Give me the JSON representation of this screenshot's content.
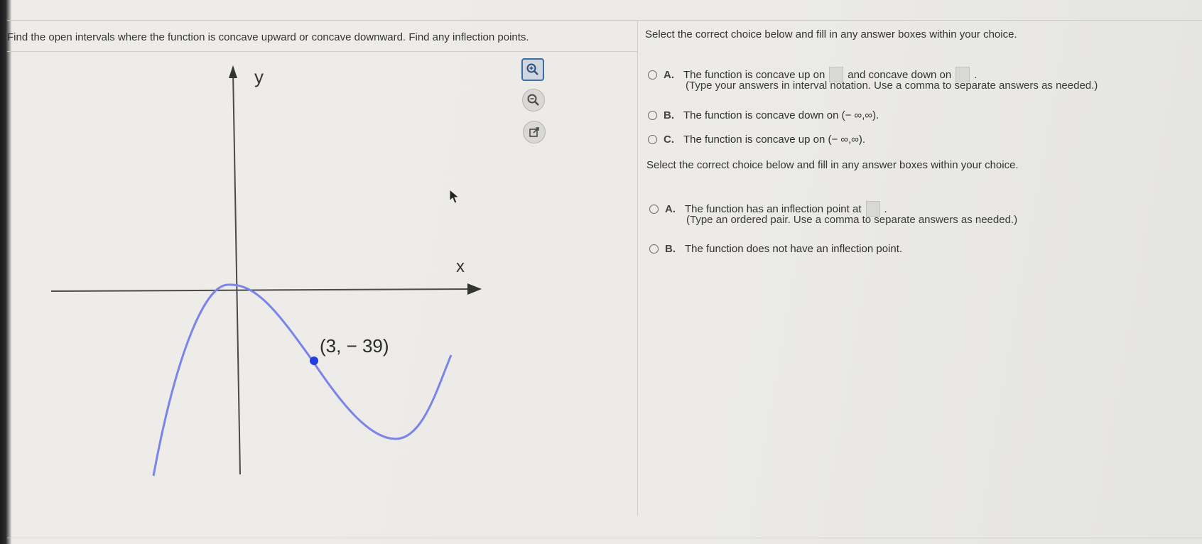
{
  "question": {
    "text": "Find the open intervals where the function is concave upward or concave downward. Find any inflection points."
  },
  "graph": {
    "y_label": "y",
    "x_label": "x",
    "point_label": "(3, − 39)"
  },
  "tools": {
    "icons": [
      "zoom-in-icon",
      "zoom-out-icon",
      "open-new-window-icon"
    ]
  },
  "section1": {
    "instruction": "Select the correct choice below and fill in any answer boxes within your choice.",
    "choices": [
      {
        "letter": "A.",
        "text1": "The function is concave up on",
        "text2": "and concave down on",
        "text3": "."
      },
      {
        "letter": "B.",
        "text1": "The function is concave down on (− ∞,∞)."
      },
      {
        "letter": "C.",
        "text1": "The function is concave up on (− ∞,∞)."
      }
    ],
    "hint": "(Type your answers in interval notation. Use a comma to separate answers as needed.)"
  },
  "section2": {
    "instruction": "Select the correct choice below and fill in any answer boxes within your choice.",
    "choices": [
      {
        "letter": "A.",
        "text1": "The function has an inflection point at",
        "text3": "."
      },
      {
        "letter": "B.",
        "text1": "The function does not have an inflection point."
      }
    ],
    "hint": "(Type an ordered pair. Use a comma to separate answers as needed.)"
  },
  "colors": {
    "curve": "#7b84e8",
    "point": "#1f3fe0",
    "axis": "#4a4a4a",
    "accent": "#3b6ea5"
  }
}
